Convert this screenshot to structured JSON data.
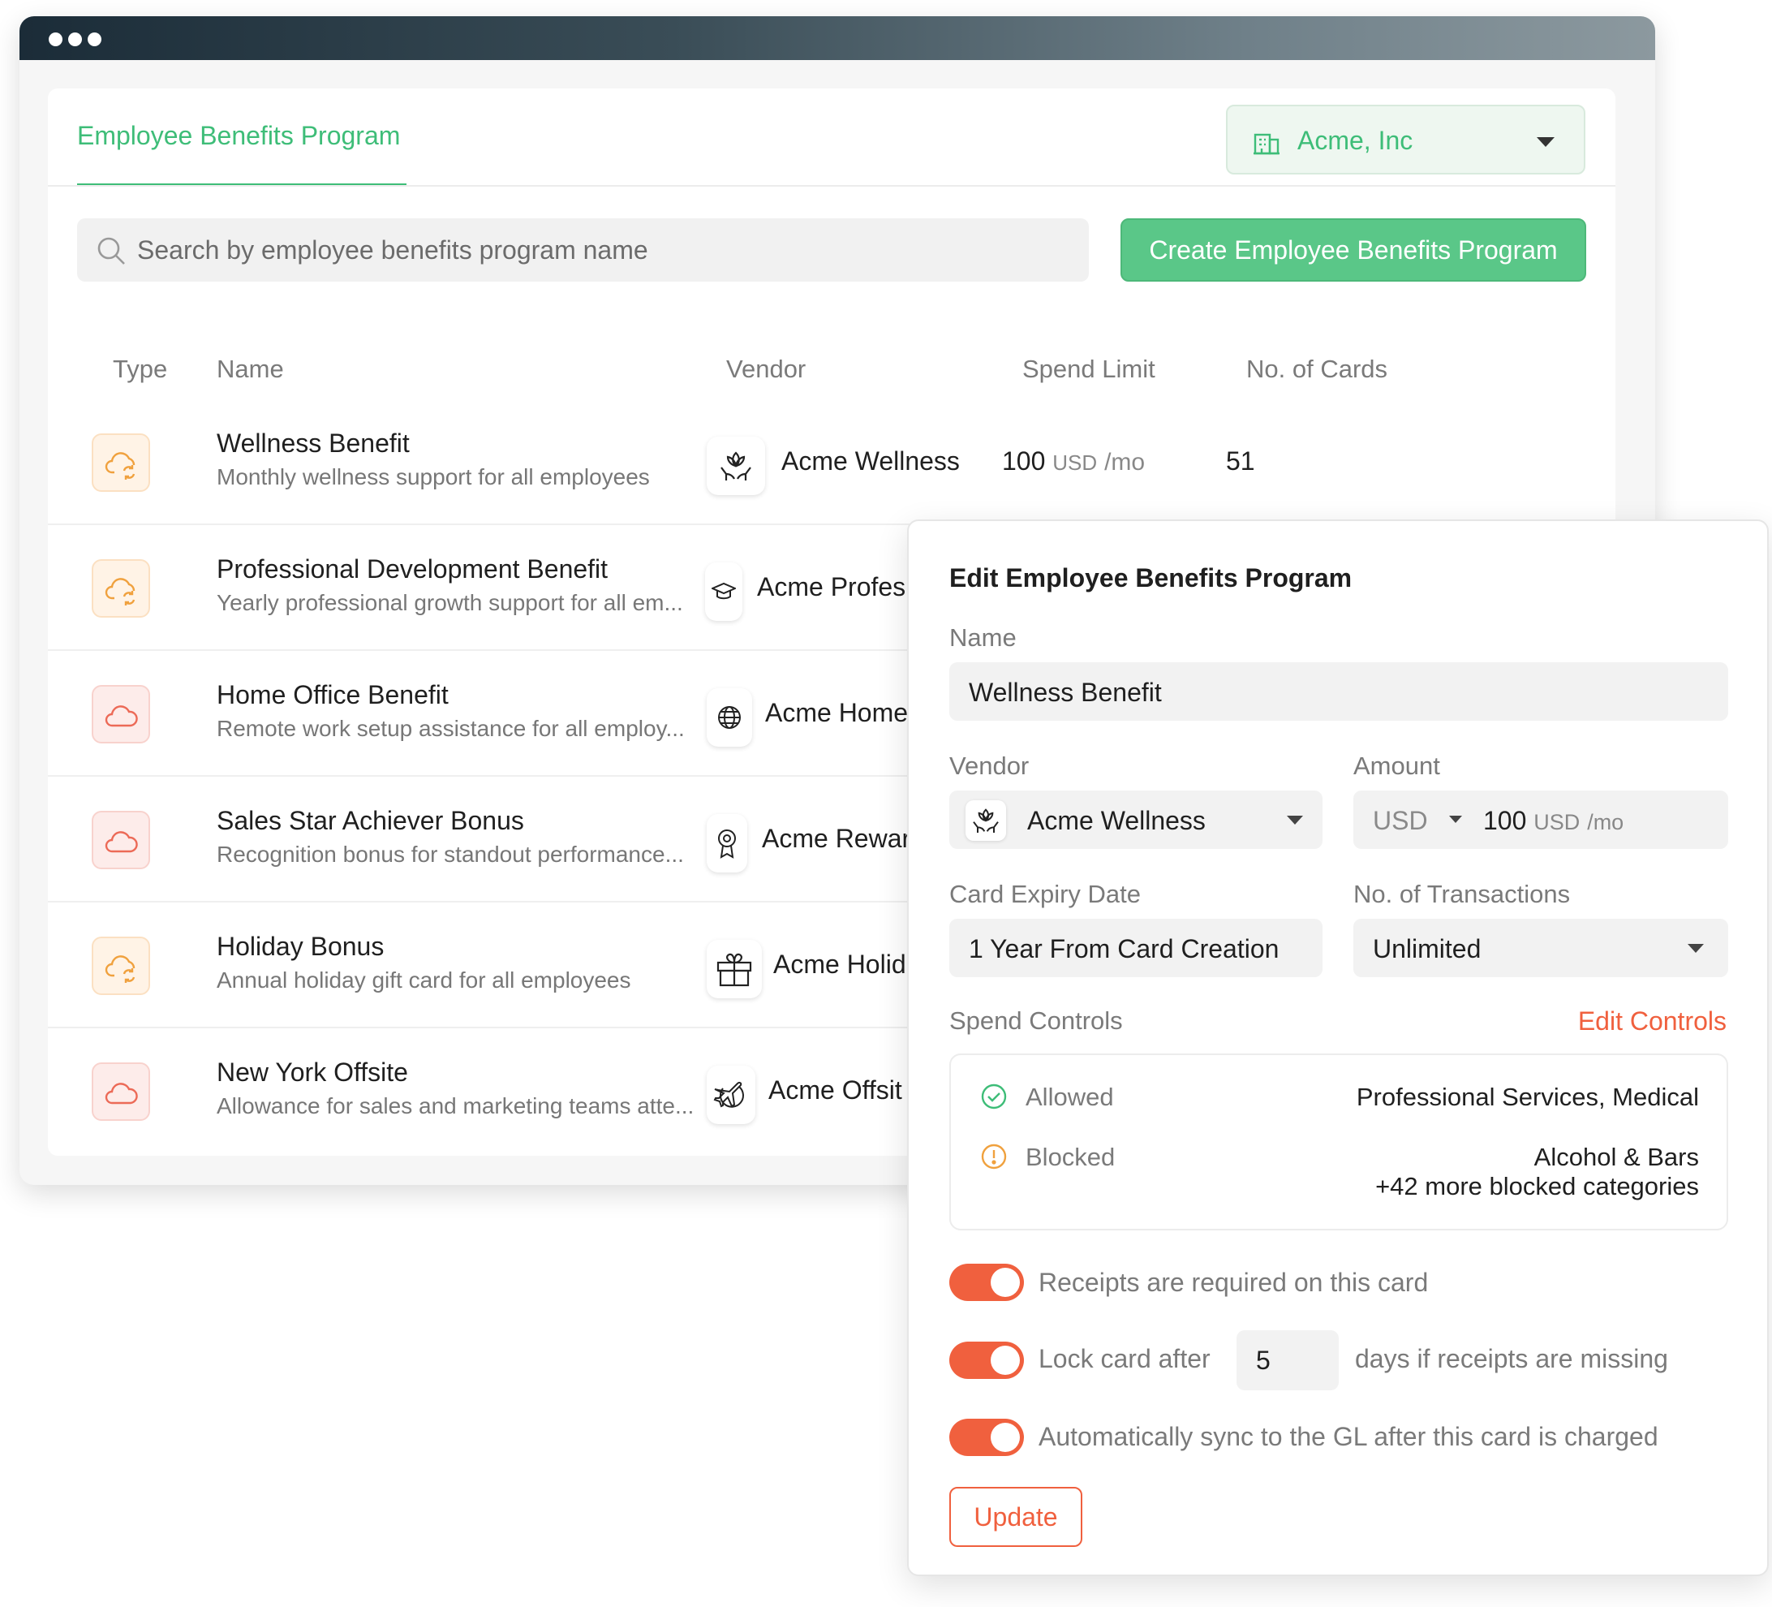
{
  "header": {
    "tab_title": "Employee Benefits Program",
    "company": "Acme, Inc"
  },
  "search": {
    "placeholder": "Search by employee benefits program name"
  },
  "create_button": "Create Employee Benefits Program",
  "table": {
    "columns": [
      "Type",
      "Name",
      "Vendor",
      "Spend Limit",
      "No. of Cards"
    ],
    "rows": [
      {
        "type": "cloud-sync-icon",
        "name": "Wellness Benefit",
        "description": "Monthly wellness support for all employees",
        "vendor_icon": "lotus-hands-icon",
        "vendor": "Acme Wellness",
        "limit_amount": "100",
        "limit_unit": "USD",
        "limit_period": "/mo",
        "cards": "51"
      },
      {
        "type": "cloud-sync-icon",
        "name": "Professional Development Benefit",
        "description": "Yearly professional growth support for all em...",
        "vendor_icon": "graduation-cap-icon",
        "vendor": "Acme Profes"
      },
      {
        "type": "cloud-icon",
        "name": "Home Office Benefit",
        "description": "Remote work setup assistance for all employ...",
        "vendor_icon": "globe-icon",
        "vendor": "Acme Home"
      },
      {
        "type": "cloud-icon",
        "name": "Sales Star Achiever Bonus",
        "description": "Recognition bonus for standout performance...",
        "vendor_icon": "award-icon",
        "vendor": "Acme Rewar"
      },
      {
        "type": "cloud-sync-icon",
        "name": "Holiday Bonus",
        "description": "Annual holiday gift card for all employees",
        "vendor_icon": "gift-icon",
        "vendor": "Acme Holid"
      },
      {
        "type": "cloud-icon",
        "name": "New York Offsite",
        "description": "Allowance for sales and marketing teams atte...",
        "vendor_icon": "plane-globe-icon",
        "vendor": "Acme Offsit"
      }
    ]
  },
  "edit_panel": {
    "title": "Edit Employee Benefits Program",
    "name_label": "Name",
    "name_value": "Wellness Benefit",
    "vendor_label": "Vendor",
    "vendor_value": "Acme Wellness",
    "amount_label": "Amount",
    "currency": "USD",
    "amount_value": "100",
    "amount_unit": "USD",
    "amount_period": "/mo",
    "expiry_label": "Card Expiry Date",
    "expiry_value": "1 Year From Card Creation",
    "transactions_label": "No. of Transactions",
    "transactions_value": "Unlimited",
    "spend_controls_label": "Spend Controls",
    "edit_controls": "Edit Controls",
    "allowed_label": "Allowed",
    "allowed_value": "Professional Services, Medical",
    "blocked_label": "Blocked",
    "blocked_value_1": "Alcohol & Bars",
    "blocked_value_2": "+42 more blocked categories",
    "toggle_receipts": "Receipts are required on this card",
    "toggle_lock_prefix": "Lock card after",
    "lock_days": "5",
    "toggle_lock_suffix": "days if receipts are missing",
    "toggle_sync": "Automatically sync to the GL after this card is charged",
    "update_button": "Update"
  },
  "colors": {
    "brand_green": "#3ebd78",
    "create_button_bg": "#5ac788",
    "accent_orange": "#f0603e",
    "titlebar_dark": "#1b2c38"
  }
}
